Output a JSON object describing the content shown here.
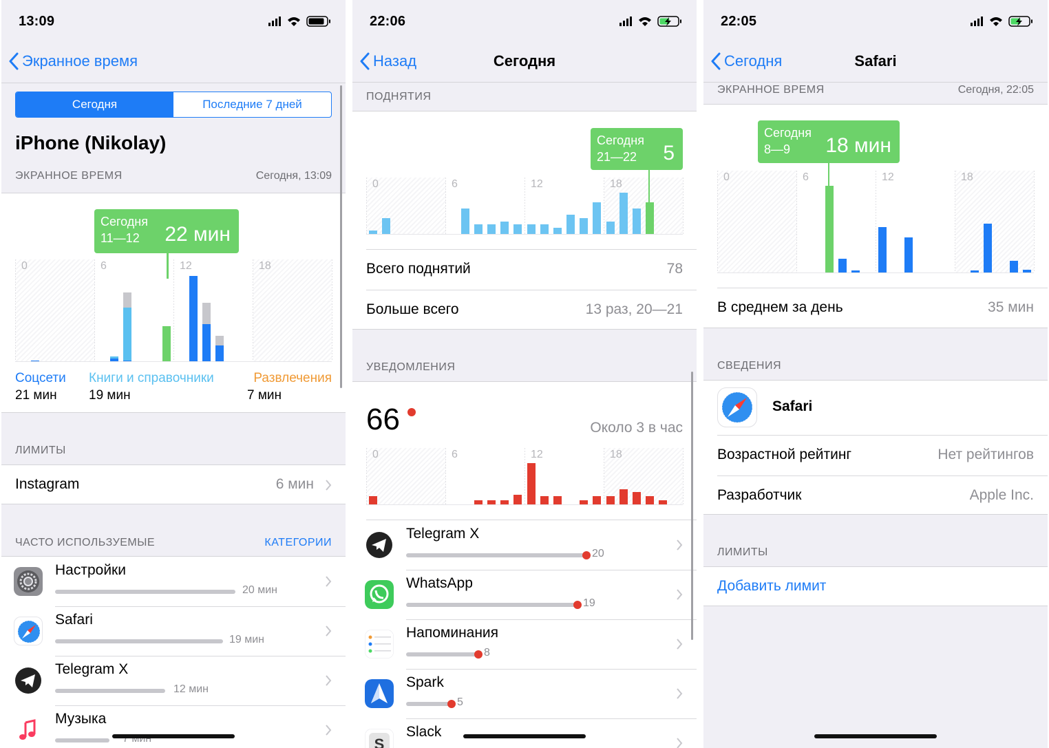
{
  "colors": {
    "accent": "#1e7cf6",
    "green": "#6dd26a",
    "social": "#1e7cf6",
    "books": "#5ac0f0",
    "entertainment": "#f09a35",
    "other": "#c7c7cc",
    "red": "#e23b2e"
  },
  "screen1": {
    "time": "13:09",
    "back": "Экранное время",
    "segments": [
      "Сегодня",
      "Последние 7 дней"
    ],
    "device": "iPhone (Nikolay)",
    "screen_time_label": "ЭКРАННОЕ ВРЕМЯ",
    "screen_time_date": "Сегодня, 13:09",
    "tooltip": {
      "line1": "Сегодня",
      "line2": "11—12",
      "value": "22 мин"
    },
    "legend": [
      {
        "name": "Соцсети",
        "time": "21 мин"
      },
      {
        "name": "Книги и справочники",
        "time": "19 мин"
      },
      {
        "name": "Развлечения",
        "time": "7 мин"
      }
    ],
    "limits_label": "ЛИМИТЫ",
    "limit": {
      "name": "Instagram",
      "value": "6 мин"
    },
    "frequent_label": "ЧАСТО ИСПОЛЬЗУЕМЫЕ",
    "categories_link": "КАТЕГОРИИ",
    "apps": [
      {
        "name": "Настройки",
        "time": "20 мин",
        "fraction": 1.0
      },
      {
        "name": "Safari",
        "time": "19 мин",
        "fraction": 0.93
      },
      {
        "name": "Telegram X",
        "time": "12 мин",
        "fraction": 0.61
      },
      {
        "name": "Музыка",
        "time": "7 мин",
        "fraction": 0.3
      }
    ]
  },
  "screen2": {
    "time": "22:06",
    "back": "Назад",
    "title": "Сегодня",
    "pickups_label": "ПОДНЯТИЯ",
    "tooltip": {
      "line1": "Сегодня",
      "line2": "21—22",
      "value": "5"
    },
    "total_label": "Всего поднятий",
    "total_value": "78",
    "most_label": "Больше всего",
    "most_value": "13 раз, 20—21",
    "notif_label": "УВЕДОМЛЕНИЯ",
    "notif_count": "66",
    "notif_rate": "Около 3 в час",
    "apps": [
      {
        "name": "Telegram X",
        "count": "20",
        "fraction": 1.0
      },
      {
        "name": "WhatsApp",
        "count": "19",
        "fraction": 0.95
      },
      {
        "name": "Напоминания",
        "count": "8",
        "fraction": 0.4
      },
      {
        "name": "Spark",
        "count": "5",
        "fraction": 0.25
      },
      {
        "name": "Slack",
        "count": "",
        "fraction": 0.1
      }
    ]
  },
  "screen3": {
    "time": "22:05",
    "back": "Сегодня",
    "title": "Safari",
    "screen_time_label": "ЭКРАННОЕ ВРЕМЯ",
    "screen_time_date": "Сегодня, 22:05",
    "tooltip": {
      "line1": "Сегодня",
      "line2": "8—9",
      "value": "18 мин"
    },
    "avg_label": "В среднем за день",
    "avg_value": "35 мин",
    "info_label": "СВЕДЕНИЯ",
    "app_name": "Safari",
    "rating_label": "Возрастной рейтинг",
    "rating_value": "Нет рейтингов",
    "dev_label": "Разработчик",
    "dev_value": "Apple Inc.",
    "limits_label": "ЛИМИТЫ",
    "add_limit": "Добавить лимит"
  },
  "chart_data": [
    {
      "type": "bar",
      "title": "",
      "x": [
        0,
        1,
        2,
        3,
        4,
        5,
        6,
        7,
        8,
        9,
        10,
        11,
        12,
        13,
        14,
        15,
        16,
        17,
        18,
        19,
        20,
        21,
        22,
        23
      ],
      "tick_labels": [
        "0",
        "6",
        "12",
        "18"
      ],
      "series": [
        {
          "name": "Соцсети",
          "values": [
            0,
            0.1,
            0,
            0,
            0,
            0,
            0,
            0.8,
            0.2,
            0,
            0,
            0.4,
            0,
            22,
            9.5,
            4,
            0,
            0,
            0,
            0,
            0,
            0,
            0,
            0
          ]
        },
        {
          "name": "Книги и справочники",
          "values": [
            0,
            0,
            0,
            0,
            0,
            0,
            0,
            0.5,
            13.6,
            0,
            0,
            0.2,
            0,
            0,
            0,
            0,
            0,
            0,
            0,
            0,
            0,
            0,
            0,
            0
          ]
        },
        {
          "name": "Развлечения",
          "values": [
            0,
            0,
            0,
            0,
            0,
            0,
            0,
            0,
            0,
            0,
            0,
            5,
            0,
            0,
            0,
            0,
            0,
            0,
            0,
            0,
            0,
            0,
            0,
            0
          ]
        },
        {
          "name": "",
          "values": [
            0,
            0,
            0,
            0,
            0,
            0,
            0,
            0,
            4,
            0,
            0,
            3.5,
            0,
            0,
            5.5,
            2.5,
            0,
            0,
            0,
            0,
            0,
            0,
            0,
            0
          ]
        }
      ],
      "ylim": [
        0,
        22
      ]
    },
    {
      "type": "bar",
      "title": "",
      "x": [
        0,
        1,
        2,
        3,
        4,
        5,
        6,
        7,
        8,
        9,
        10,
        11,
        12,
        13,
        14,
        15,
        16,
        17,
        18,
        19,
        20,
        21,
        22,
        23
      ],
      "tick_labels": [
        "0",
        "6",
        "12",
        "18"
      ],
      "series": [
        {
          "name": "",
          "values": [
            0.5,
            2.5,
            0,
            0,
            0,
            0,
            0,
            4,
            1.5,
            1.5,
            2,
            1.5,
            1.5,
            1.5,
            1,
            3,
            2.5,
            5,
            2,
            6.5,
            4,
            5,
            0,
            0
          ]
        }
      ]
    },
    {
      "type": "bar",
      "title": "",
      "x": [
        0,
        1,
        2,
        3,
        4,
        5,
        6,
        7,
        8,
        9,
        10,
        11,
        12,
        13,
        14,
        15,
        16,
        17,
        18,
        19,
        20,
        21,
        22,
        23
      ],
      "tick_labels": [
        "0",
        "6",
        "12",
        "18"
      ],
      "series": [
        {
          "name": "",
          "values": [
            1,
            0,
            0,
            0,
            0,
            0,
            0,
            0,
            0.5,
            0.5,
            0.5,
            1.2,
            5,
            1,
            1,
            0,
            0.5,
            1,
            1,
            1.8,
            1.5,
            1,
            0.5,
            0
          ]
        }
      ]
    },
    {
      "type": "bar",
      "title": "",
      "x": [
        0,
        1,
        2,
        3,
        4,
        5,
        6,
        7,
        8,
        9,
        10,
        11,
        12,
        13,
        14,
        15,
        16,
        17,
        18,
        19,
        20,
        21,
        22,
        23
      ],
      "tick_labels": [
        "0",
        "6",
        "12",
        "18"
      ],
      "series": [
        {
          "name": "",
          "values": [
            0,
            0,
            0,
            0,
            0,
            0,
            0,
            0,
            18,
            2.8,
            0.4,
            0,
            9.5,
            0,
            7.3,
            0,
            0,
            0,
            0,
            0.4,
            10.2,
            0,
            2.4,
            0.6
          ]
        }
      ]
    }
  ]
}
